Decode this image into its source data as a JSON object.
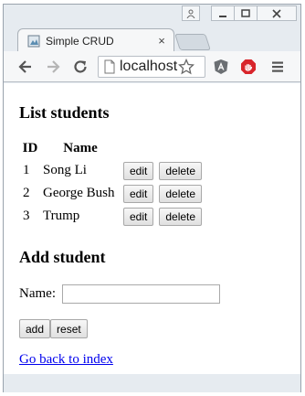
{
  "browser": {
    "tab_title": "Simple CRUD",
    "tab_close": "×",
    "address": "localhost"
  },
  "page": {
    "list_heading": "List students",
    "columns": [
      "ID",
      "Name"
    ],
    "students": [
      {
        "id": "1",
        "name": "Song Li"
      },
      {
        "id": "2",
        "name": "George Bush"
      },
      {
        "id": "3",
        "name": "Trump"
      }
    ],
    "edit_label": "edit",
    "delete_label": "delete",
    "add_heading": "Add student",
    "name_label": "Name:",
    "name_value": "",
    "add_button": "add",
    "reset_button": "reset",
    "back_link": "Go back to index"
  },
  "colors": {
    "link": "#0000ee",
    "frame": "#e6ebf0"
  }
}
